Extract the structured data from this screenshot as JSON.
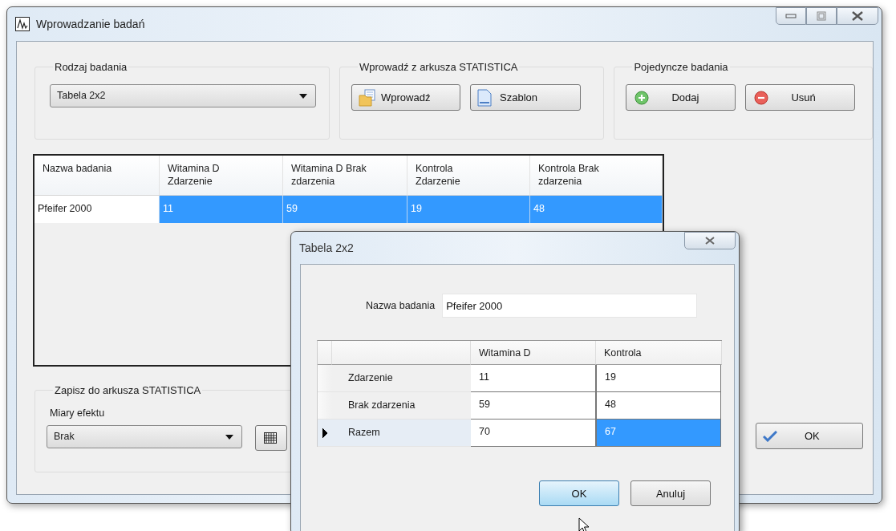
{
  "window": {
    "title": "Wprowadzanie badań"
  },
  "study_type": {
    "label": "Rodzaj badania",
    "value": "Tabela 2x2"
  },
  "import": {
    "label": "Wprowadź z arkusza STATISTICA",
    "buttons": [
      {
        "label": "Wprowadź"
      },
      {
        "label": "Szablon"
      }
    ]
  },
  "single": {
    "label": "Pojedyncze badania",
    "buttons": [
      {
        "label": "Dodaj"
      },
      {
        "label": "Usuń"
      }
    ]
  },
  "table": {
    "columns": [
      "Nazwa badania",
      "Witamina D Zdarzenie",
      "Witamina D Brak zdarzenia",
      "Kontrola Zdarzenie",
      "Kontrola Brak zdarzenia"
    ],
    "rows": [
      {
        "cells": [
          {
            "text": "Pfeifer 2000",
            "selected": false
          },
          {
            "text": "11",
            "selected": true
          },
          {
            "text": "59",
            "selected": true
          },
          {
            "text": "19",
            "selected": true
          },
          {
            "text": "48",
            "selected": true
          }
        ]
      }
    ]
  },
  "export": {
    "label": "Zapisz do arkusza STATISTICA",
    "sublabel": "Miary efektu",
    "value": "Brak"
  },
  "ok_button": "OK",
  "dialog": {
    "title": "Tabela 2x2",
    "name_label": "Nazwa badania",
    "name_value": "Pfeifer 2000",
    "grid": {
      "columns": [
        "Witamina D",
        "Kontrola"
      ],
      "rows": [
        {
          "label": "Zdarzenie",
          "current": false,
          "cells": [
            {
              "text": "11",
              "selected": false
            },
            {
              "text": "19",
              "selected": false
            }
          ]
        },
        {
          "label": "Brak zdarzenia",
          "current": false,
          "cells": [
            {
              "text": "59",
              "selected": false
            },
            {
              "text": "48",
              "selected": false
            }
          ]
        },
        {
          "label": "Razem",
          "current": true,
          "cells": [
            {
              "text": "70",
              "selected": false
            },
            {
              "text": "67",
              "selected": true
            }
          ]
        }
      ]
    },
    "buttons": [
      {
        "label": "OK",
        "highlighted": true
      },
      {
        "label": "Anuluj",
        "highlighted": false
      }
    ]
  }
}
